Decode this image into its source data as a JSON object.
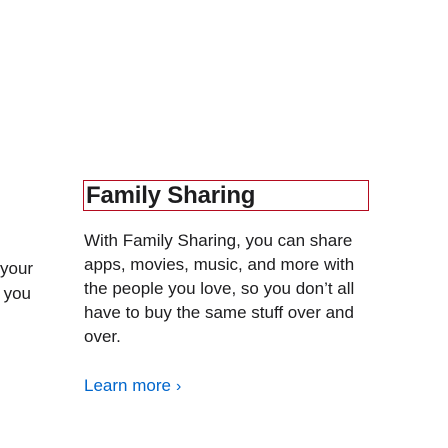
{
  "left_clipped": {
    "line1": "your",
    "line2": "you"
  },
  "feature": {
    "title": "Family Sharing",
    "description": "With Family Sharing, you can share apps, movies, music, and more with the people you love, so you don’t all have to buy the same stuff over and over.",
    "link_label": "Learn more",
    "link_chevron": "›"
  },
  "colors": {
    "text": "#1d1d1f",
    "link": "#0066cc",
    "focus_outline": "#b30a1e"
  }
}
